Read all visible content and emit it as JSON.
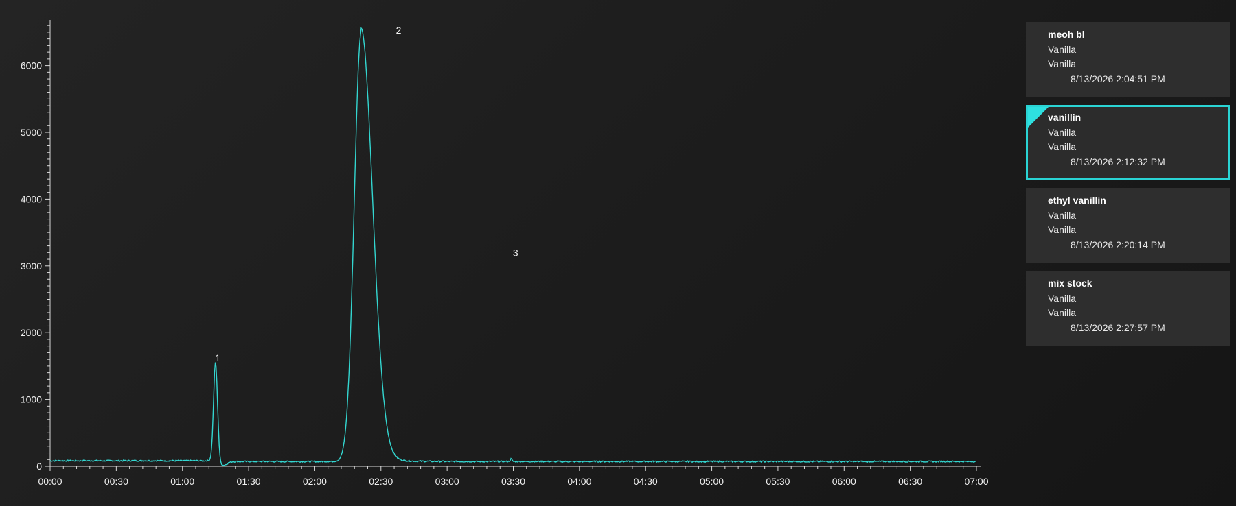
{
  "chart_data": {
    "type": "line",
    "x_unit": "mm:ss",
    "xlim": [
      "00:00",
      "07:00"
    ],
    "ylim": [
      0,
      6700
    ],
    "x_ticks": [
      "00:00",
      "00:30",
      "01:00",
      "01:30",
      "02:00",
      "02:30",
      "03:00",
      "03:30",
      "04:00",
      "04:30",
      "05:00",
      "05:30",
      "06:00",
      "06:30",
      "07:00"
    ],
    "y_ticks": [
      0,
      1000,
      2000,
      3000,
      4000,
      5000,
      6000
    ],
    "series": [
      {
        "color": "#33d6d0",
        "baseline": 70,
        "peaks": [
          {
            "label": "1",
            "rt": "01:15",
            "height": 1550
          },
          {
            "label": "2",
            "rt": "02:21",
            "height": 6480
          },
          {
            "label": "3",
            "rt": "03:29",
            "height": 110
          }
        ]
      }
    ],
    "peak_labels": [
      {
        "text": "1",
        "x": "01:16",
        "y": 1620
      },
      {
        "text": "2",
        "x": "02:38",
        "y": 6530
      },
      {
        "text": "3",
        "x": "03:31",
        "y": 3200
      }
    ],
    "grid": false
  },
  "samples": [
    {
      "name": "meoh bl",
      "line1": "Vanilla",
      "line2": "Vanilla",
      "date": "8/13/2026 2:04:51 PM",
      "selected": false
    },
    {
      "name": "vanillin",
      "line1": "Vanilla",
      "line2": "Vanilla",
      "date": "8/13/2026 2:12:32 PM",
      "selected": true
    },
    {
      "name": "ethyl vanillin",
      "line1": "Vanilla",
      "line2": "Vanilla",
      "date": "8/13/2026 2:20:14 PM",
      "selected": false
    },
    {
      "name": "mix stock",
      "line1": "Vanilla",
      "line2": "Vanilla",
      "date": "8/13/2026 2:27:57 PM",
      "selected": false
    }
  ],
  "colors": {
    "accent": "#2ad4d4",
    "trace": "#33d6d0",
    "background": "#1c1c1c",
    "card": "#2e2e2e"
  }
}
